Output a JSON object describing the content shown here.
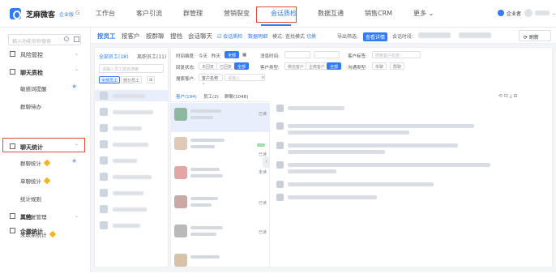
{
  "topbar": {
    "brand": "芝麻微客",
    "brand_sub": "企业版",
    "brand_g": "G",
    "nav": [
      "工作台",
      "客户引流",
      "群管理",
      "营销裂变",
      "会话质检",
      "数据互通",
      "销售CRM",
      "更多 ⌄"
    ],
    "active_nav": "会话质检",
    "user_label": "企业者"
  },
  "sidebar": {
    "search_placeholder": "输入功能名称搜索",
    "groups": [
      {
        "label": "风险管控",
        "chevron": "⌄"
      },
      {
        "label": "聊天质检",
        "chevron": "⌃",
        "children": [
          "敏感词提醒",
          "群聊待办"
        ]
      },
      {
        "label": "聊天统计",
        "chevron": "⌃",
        "children": [
          "群聊统计",
          "单聊统计",
          "统计规则",
          "未回复管理",
          "未联系统计"
        ]
      },
      {
        "label": "其他",
        "chevron": "⌄"
      },
      {
        "label": "企微统计",
        "chevron": ""
      }
    ]
  },
  "main": {
    "tabs": [
      "按员工",
      "按客户",
      "按群聊",
      "搜档",
      "会话聊天"
    ],
    "links": [
      "☑ 会话质检",
      "数据明细"
    ],
    "mode_label": "模式:",
    "mode_value": "查找模式",
    "mode_action": "切换",
    "right_labels": [
      "导出筛选:",
      "查看详情",
      "会话时段:"
    ],
    "refresh": "⟳ 刷新",
    "col1_tabs": [
      "全部员工(18)",
      "离职员工(11)"
    ],
    "col1_search_placeholder": "请输入员工姓名搜索",
    "col1_chips": [
      "全部员工",
      "部分员工",
      "⊞"
    ],
    "filters": {
      "time_label": "时间维度:",
      "time_options": [
        "今天",
        "昨天",
        "全部"
      ],
      "msg_label": "消息时间:",
      "cust_label": "客户标签:",
      "cust_placeholder": "搜索客户标签",
      "reply_label": "回复状态:",
      "reply_options": [
        "未回复",
        "已回复",
        "全部"
      ],
      "type_label": "客户类型:",
      "type_options": [
        "微信客户",
        "企微客户",
        "全部"
      ],
      "chat_label": "沟通类型:",
      "chat_options": [
        "单聊",
        "群聊"
      ],
      "group_label": "搜索客户:",
      "group_select": "客户名称 ⌄",
      "group_placeholder": "请输入"
    },
    "chat_tabs": [
      "客户(194)",
      "员工(2)",
      "群聊(1048)"
    ],
    "chat_status": [
      "已读",
      "已读",
      "未读",
      "已读",
      "已读"
    ],
    "panel_icons": "⟲ ⊡ ⤓ ⊟"
  }
}
